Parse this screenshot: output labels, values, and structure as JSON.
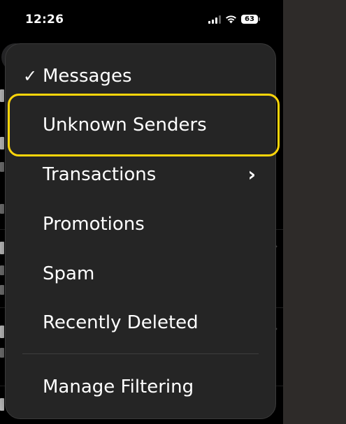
{
  "status_bar": {
    "time": "12:26",
    "battery": "63"
  },
  "menu": {
    "items": [
      {
        "label": "Messages",
        "checked": true,
        "submenu": false
      },
      {
        "label": "Unknown Senders",
        "checked": false,
        "submenu": false,
        "highlighted": true
      },
      {
        "label": "Transactions",
        "checked": false,
        "submenu": true
      },
      {
        "label": "Promotions",
        "checked": false,
        "submenu": false
      },
      {
        "label": "Spam",
        "checked": false,
        "submenu": false
      },
      {
        "label": "Recently Deleted",
        "checked": false,
        "submenu": false
      },
      {
        "label": "Manage Filtering",
        "checked": false,
        "submenu": false
      }
    ],
    "check_glyph": "✓",
    "chevron_glyph": "›"
  },
  "colors": {
    "highlight_border": "#ffd60a",
    "menu_background": "#252525",
    "screen_background": "#000000",
    "side_background": "#2e2b29"
  }
}
